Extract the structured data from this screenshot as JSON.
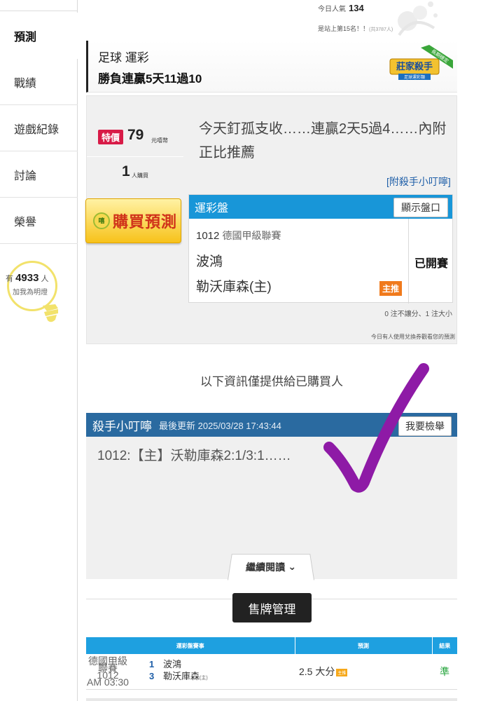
{
  "sidebar": {
    "items": [
      {
        "label": "預測",
        "active": true
      },
      {
        "label": "戰績"
      },
      {
        "label": "遊戲紀錄"
      },
      {
        "label": "討論"
      },
      {
        "label": "榮譽"
      }
    ],
    "fans": {
      "prefix": "有",
      "count": "4933",
      "suffix": "人",
      "line2": "加我為明燈"
    }
  },
  "top": {
    "popularity_label": "今日人氣",
    "popularity_value": "134",
    "rank_text": "是站上第15名！！",
    "rank_small": "(共3787人)"
  },
  "header": {
    "line1": "足球 運彩",
    "line2": "勝負連贏5天11過10",
    "badge_text": "莊家殺手",
    "badge_sub": "足球運彩類",
    "badge_ribbon": "長期穩定"
  },
  "offer": {
    "special_label": "特價",
    "price": "79",
    "price_unit": "元嘻幣",
    "buyers": "1",
    "buyers_unit": "人購買",
    "buy_coin": "嘻",
    "buy_label": "購買預測",
    "headline": "今天釘孤支收……連贏2天5過4……內附正比推薦",
    "tip_link": "[附殺手小叮嚀]"
  },
  "odds": {
    "title": "運彩盤",
    "show_button": "顯示盤口",
    "match_no": "1012",
    "league": "德國甲級聯賽",
    "team1": "波鴻",
    "team2": "勒沃庫森(主)",
    "tag": "主推",
    "status": "已開賽",
    "note1": "0 注不讓分、1 注大小",
    "note2": "今日有人使用兌換券觀看您的預測"
  },
  "info_line": "以下資訊僅提供給已購買人",
  "tip": {
    "title": "殺手小叮嚀",
    "updated": "最後更新 2025/03/28 17:43:44",
    "report_button": "我要檢舉",
    "text": "1012:【主】沃勒庫森2:1/3:1……",
    "more_button": "繼續閱讀"
  },
  "manage_button": "售牌管理",
  "results": {
    "headers": [
      "運彩盤賽事",
      "預測",
      "結果"
    ],
    "rows": [
      {
        "league": "德國甲級聯賽",
        "match_no": "1012",
        "time": "AM 03:30",
        "team1_no": "1",
        "team1": "波鴻",
        "team2_no": "3",
        "team2": "勒沃庫森",
        "team2_tag": "(主)",
        "prediction": "2.5 大分",
        "prediction_tag": "主推",
        "result": "準"
      }
    ]
  },
  "colors": {
    "blue_header": "#1896d8",
    "tip_header": "#2a6aa0",
    "special": "#d81b47",
    "check": "#8e1aa6",
    "accent_orange": "#f07a1c"
  }
}
